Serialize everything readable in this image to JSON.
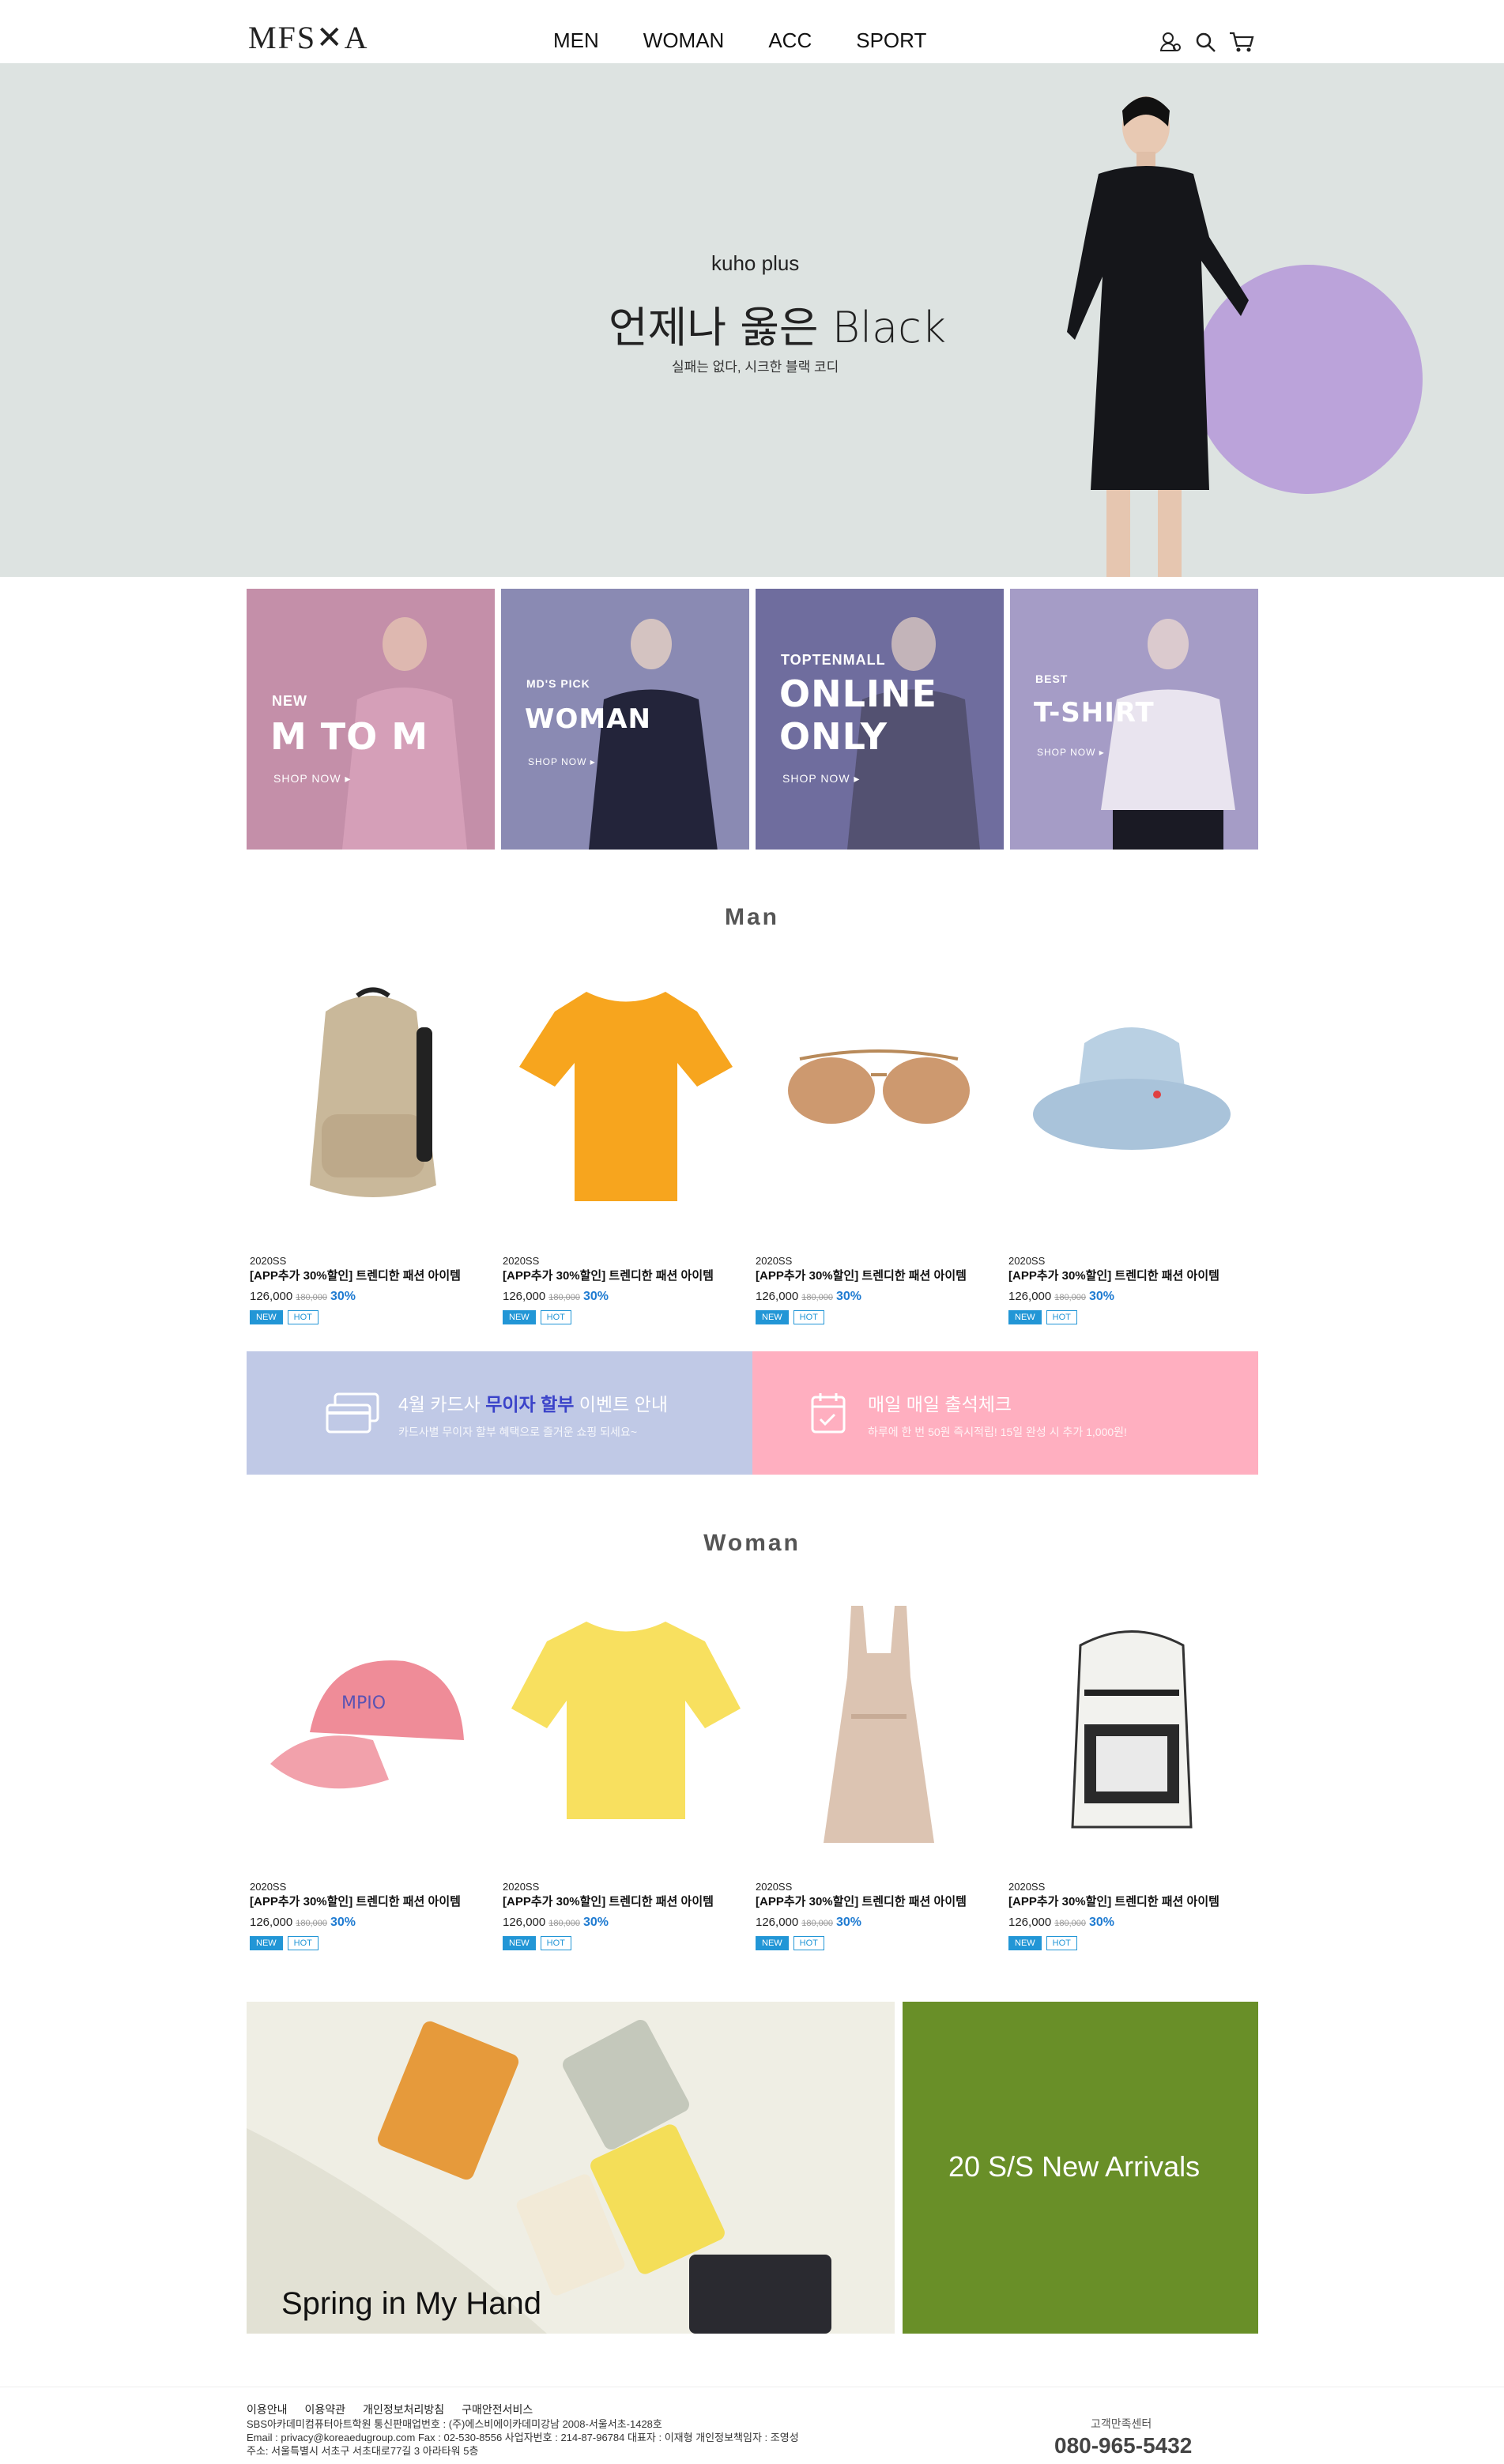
{
  "header": {
    "logo": "MFS✕A",
    "nav": [
      "MEN",
      "WOMAN",
      "ACC",
      "SPORT"
    ],
    "icons": [
      "user-icon",
      "search-icon",
      "cart-icon"
    ]
  },
  "hero": {
    "subtitle": "kuho plus",
    "title": "언제나 옳은 Black",
    "desc": "실패는 없다, 시크한 블랙 코디"
  },
  "banners": [
    {
      "tag": "NEW",
      "title": "M TO M",
      "title2": "",
      "shop": "SHOP NOW ▸",
      "color": "#c48fa9"
    },
    {
      "tag": "MD'S PICK",
      "title": "WOMAN",
      "title2": "",
      "shop": "SHOP NOW ▸",
      "color": "#7f7fa8"
    },
    {
      "tag": "TOPTENMALL",
      "title": "ONLINE",
      "title2": "ONLY",
      "shop": "SHOP NOW ▸",
      "color": "#6f6d9e"
    },
    {
      "tag": "BEST",
      "title": "T-SHIRT",
      "title2": "",
      "shop": "SHOP NOW ▸",
      "color": "#9f96c2"
    }
  ],
  "sections": {
    "man": "Man",
    "woman": "Woman"
  },
  "product_common": {
    "season": "2020SS",
    "name": "[APP추가 30%할인] 트렌디한 패션 아이템",
    "price": "126,000",
    "old_price": "180,000",
    "discount": "30%",
    "badge_new": "NEW",
    "badge_hot": "HOT"
  },
  "man_products": [
    {
      "icon": "backpack-icon"
    },
    {
      "icon": "tshirt-icon"
    },
    {
      "icon": "sunglasses-icon"
    },
    {
      "icon": "bucket-hat-icon"
    }
  ],
  "woman_products": [
    {
      "icon": "cap-icon"
    },
    {
      "icon": "tshirt-icon"
    },
    {
      "icon": "dress-icon"
    },
    {
      "icon": "backpack-icon"
    }
  ],
  "events": [
    {
      "title_pre": "4월 카드사 ",
      "title_hl": "무이자 할부",
      "title_post": " 이벤트 안내",
      "desc": "카드사별 무이자 할부 혜택으로 즐거운 쇼핑 되세요~",
      "color": "#c0c9e6"
    },
    {
      "title_pre": "매일 매일 출석체크",
      "title_hl": "",
      "title_post": "",
      "desc": "하루에 한 번 50원 즉시적립! 15일 완성 시 추가 1,000원!",
      "color": "#ffafc0"
    }
  ],
  "bottom": {
    "left_caption": "Spring in My Hand",
    "right_caption": "20 S/S New Arrivals"
  },
  "footer": {
    "links": [
      "이용안내",
      "이용약관",
      "개인정보처리방침",
      "구매안전서비스"
    ],
    "line1": "SBS아카데미컴퓨터아트학원 통신판매업번호 : (주)에스비에이카데미강남 2008-서울서초-1428호",
    "line2": "Email : privacy@koreaedugroup.com Fax : 02-530-8556 사업자번호 : 214-87-96784 대표자 : 이재형 개인정보책임자 : 조영성",
    "line3": "주소: 서울특별시 서초구 서초대로77길 3 아라타워 5층",
    "cs_label": "고객만족센터",
    "cs_number": "080-965-5432"
  }
}
